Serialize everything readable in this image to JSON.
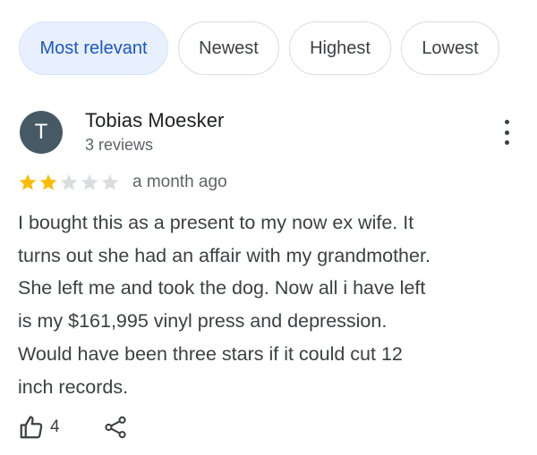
{
  "filters": {
    "chips": [
      {
        "label": "Most relevant",
        "selected": true
      },
      {
        "label": "Newest",
        "selected": false
      },
      {
        "label": "Highest",
        "selected": false
      },
      {
        "label": "Lowest",
        "selected": false
      }
    ]
  },
  "review": {
    "avatar_initial": "T",
    "reviewer_name": "Tobias Moesker",
    "reviewer_meta": "3 reviews",
    "rating": 2,
    "rating_max": 5,
    "date": "a month ago",
    "text": "I bought this as a present to my now ex wife. It\nturns out she had an affair with my grandmother.\nShe left me and took the dog. Now all i have left\nis my $161,995 vinyl press and depression.\nWould have been three stars if it could cut 12\ninch records.",
    "like_count": "4"
  },
  "icons": {
    "more": "more-vert-icon",
    "like": "thumbs-up-icon",
    "share": "share-icon",
    "star": "star-icon"
  },
  "colors": {
    "star_filled": "#fbbc04",
    "star_empty": "#dadce0",
    "chip_selected_bg": "#e8f0fe",
    "chip_selected_text": "#1a56c4",
    "avatar_bg": "#455a64"
  }
}
